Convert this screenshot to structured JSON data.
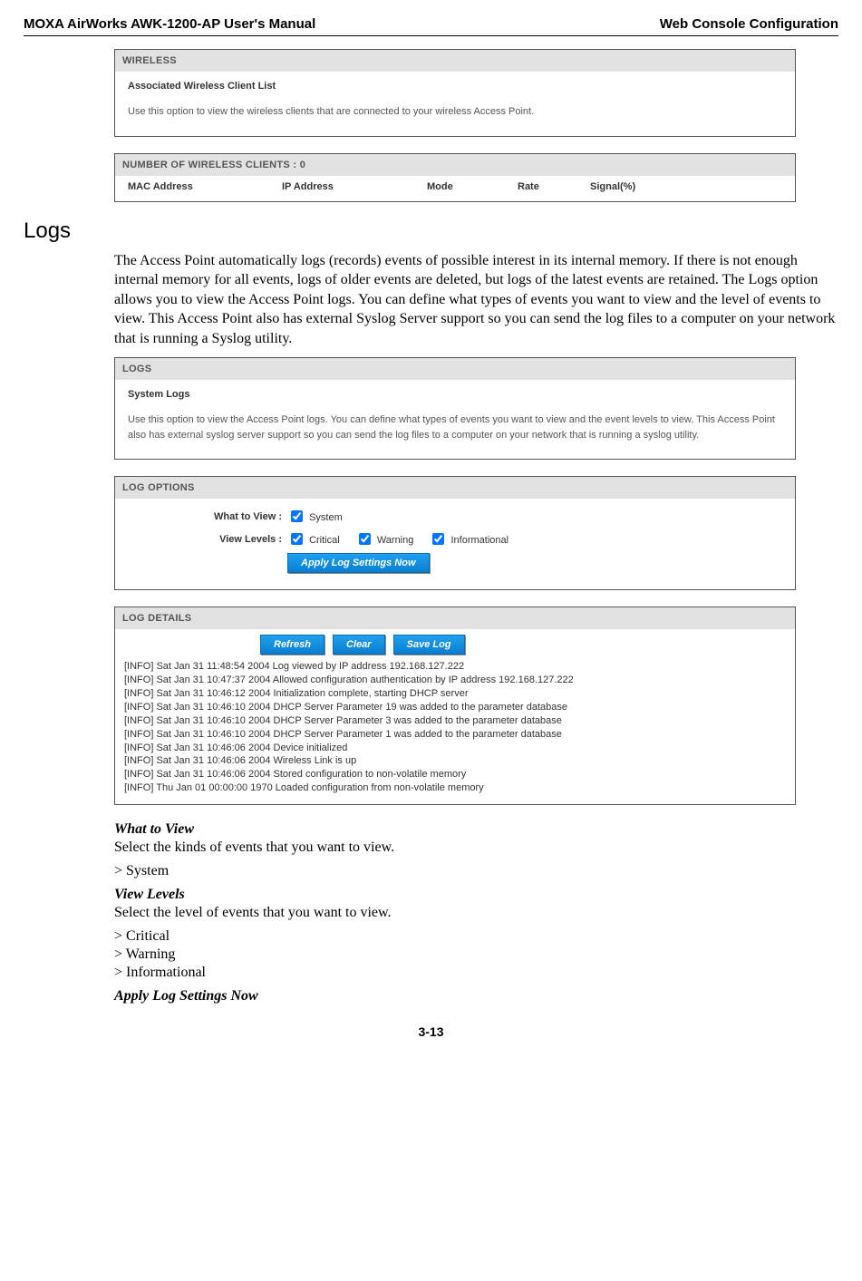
{
  "header": {
    "left": "MOXA AirWorks AWK-1200-AP User's Manual",
    "right": "Web Console Configuration"
  },
  "wirelessPanel": {
    "title": "WIRELESS",
    "sub": "Associated Wireless Client List",
    "desc": "Use this option to view the wireless clients that are connected to your wireless Access Point."
  },
  "clientsPanel": {
    "title": "NUMBER OF WIRELESS CLIENTS : 0",
    "cols": [
      "MAC Address",
      "IP Address",
      "Mode",
      "Rate",
      "Signal(%)"
    ]
  },
  "logsSection": {
    "heading": "Logs",
    "para": "The Access Point automatically logs (records) events of possible interest in its internal memory. If there is not enough internal memory for all events, logs of older events are deleted, but logs of the latest events are retained. The Logs option allows you to view the Access Point logs. You can define what types of events you want to view and the level of events to view. This Access Point also has external Syslog Server support so you can send the log files to a computer on your network that is running a Syslog utility."
  },
  "logsPanel": {
    "title": "LOGS",
    "sub": "System Logs",
    "desc": "Use this option to view the Access Point logs. You can define what types of events you want to view and the event levels to view. This Access Point also has external syslog server support so you can send the log files to a computer on your network that is running a syslog utility."
  },
  "logOptions": {
    "title": "LOG OPTIONS",
    "whatLabel": "What to View :",
    "viewLabel": "View Levels :",
    "systemLabel": "System",
    "criticalLabel": "Critical",
    "warningLabel": "Warning",
    "infoLabel": "Informational",
    "applyBtn": "Apply Log Settings Now"
  },
  "logDetails": {
    "title": "LOG DETAILS",
    "refresh": "Refresh",
    "clear": "Clear",
    "save": "Save Log",
    "lines": [
      "[INFO] Sat Jan 31 11:48:54 2004 Log viewed by IP address 192.168.127.222",
      "[INFO] Sat Jan 31 10:47:37 2004 Allowed configuration authentication by IP address 192.168.127.222",
      "[INFO] Sat Jan 31 10:46:12 2004 Initialization complete, starting DHCP server",
      "[INFO] Sat Jan 31 10:46:10 2004 DHCP Server Parameter 19 was added to the parameter database",
      "[INFO] Sat Jan 31 10:46:10 2004 DHCP Server Parameter 3 was added to the parameter database",
      "[INFO] Sat Jan 31 10:46:10 2004 DHCP Server Parameter 1 was added to the parameter database",
      "[INFO] Sat Jan 31 10:46:06 2004 Device initialized",
      "[INFO] Sat Jan 31 10:46:06 2004 Wireless Link is up",
      "[INFO] Sat Jan 31 10:46:06 2004 Stored configuration to non-volatile memory",
      "[INFO] Thu Jan 01 00:00:00 1970 Loaded configuration from non-volatile memory"
    ]
  },
  "trailing": {
    "whatTitle": "What to View",
    "whatDesc": "Select the kinds of events that you want to view.",
    "whatItem": "> System",
    "viewTitle": "View Levels",
    "viewDesc": "Select the level of events that you want to view.",
    "viewItems": [
      "> Critical",
      "> Warning",
      "> Informational"
    ],
    "applyTitle": "Apply Log Settings Now"
  },
  "pageNum": "3-13"
}
